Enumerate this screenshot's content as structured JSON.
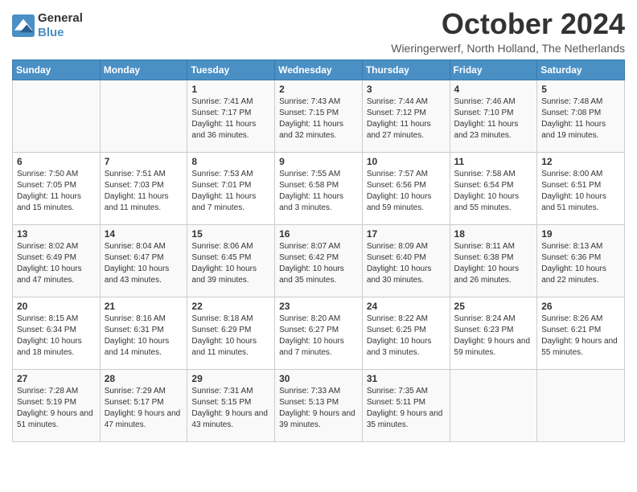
{
  "header": {
    "logo_line1": "General",
    "logo_line2": "Blue",
    "month_title": "October 2024",
    "location": "Wieringerwerf, North Holland, The Netherlands"
  },
  "weekdays": [
    "Sunday",
    "Monday",
    "Tuesday",
    "Wednesday",
    "Thursday",
    "Friday",
    "Saturday"
  ],
  "weeks": [
    [
      {
        "day": "",
        "info": ""
      },
      {
        "day": "",
        "info": ""
      },
      {
        "day": "1",
        "info": "Sunrise: 7:41 AM\nSunset: 7:17 PM\nDaylight: 11 hours and 36 minutes."
      },
      {
        "day": "2",
        "info": "Sunrise: 7:43 AM\nSunset: 7:15 PM\nDaylight: 11 hours and 32 minutes."
      },
      {
        "day": "3",
        "info": "Sunrise: 7:44 AM\nSunset: 7:12 PM\nDaylight: 11 hours and 27 minutes."
      },
      {
        "day": "4",
        "info": "Sunrise: 7:46 AM\nSunset: 7:10 PM\nDaylight: 11 hours and 23 minutes."
      },
      {
        "day": "5",
        "info": "Sunrise: 7:48 AM\nSunset: 7:08 PM\nDaylight: 11 hours and 19 minutes."
      }
    ],
    [
      {
        "day": "6",
        "info": "Sunrise: 7:50 AM\nSunset: 7:05 PM\nDaylight: 11 hours and 15 minutes."
      },
      {
        "day": "7",
        "info": "Sunrise: 7:51 AM\nSunset: 7:03 PM\nDaylight: 11 hours and 11 minutes."
      },
      {
        "day": "8",
        "info": "Sunrise: 7:53 AM\nSunset: 7:01 PM\nDaylight: 11 hours and 7 minutes."
      },
      {
        "day": "9",
        "info": "Sunrise: 7:55 AM\nSunset: 6:58 PM\nDaylight: 11 hours and 3 minutes."
      },
      {
        "day": "10",
        "info": "Sunrise: 7:57 AM\nSunset: 6:56 PM\nDaylight: 10 hours and 59 minutes."
      },
      {
        "day": "11",
        "info": "Sunrise: 7:58 AM\nSunset: 6:54 PM\nDaylight: 10 hours and 55 minutes."
      },
      {
        "day": "12",
        "info": "Sunrise: 8:00 AM\nSunset: 6:51 PM\nDaylight: 10 hours and 51 minutes."
      }
    ],
    [
      {
        "day": "13",
        "info": "Sunrise: 8:02 AM\nSunset: 6:49 PM\nDaylight: 10 hours and 47 minutes."
      },
      {
        "day": "14",
        "info": "Sunrise: 8:04 AM\nSunset: 6:47 PM\nDaylight: 10 hours and 43 minutes."
      },
      {
        "day": "15",
        "info": "Sunrise: 8:06 AM\nSunset: 6:45 PM\nDaylight: 10 hours and 39 minutes."
      },
      {
        "day": "16",
        "info": "Sunrise: 8:07 AM\nSunset: 6:42 PM\nDaylight: 10 hours and 35 minutes."
      },
      {
        "day": "17",
        "info": "Sunrise: 8:09 AM\nSunset: 6:40 PM\nDaylight: 10 hours and 30 minutes."
      },
      {
        "day": "18",
        "info": "Sunrise: 8:11 AM\nSunset: 6:38 PM\nDaylight: 10 hours and 26 minutes."
      },
      {
        "day": "19",
        "info": "Sunrise: 8:13 AM\nSunset: 6:36 PM\nDaylight: 10 hours and 22 minutes."
      }
    ],
    [
      {
        "day": "20",
        "info": "Sunrise: 8:15 AM\nSunset: 6:34 PM\nDaylight: 10 hours and 18 minutes."
      },
      {
        "day": "21",
        "info": "Sunrise: 8:16 AM\nSunset: 6:31 PM\nDaylight: 10 hours and 14 minutes."
      },
      {
        "day": "22",
        "info": "Sunrise: 8:18 AM\nSunset: 6:29 PM\nDaylight: 10 hours and 11 minutes."
      },
      {
        "day": "23",
        "info": "Sunrise: 8:20 AM\nSunset: 6:27 PM\nDaylight: 10 hours and 7 minutes."
      },
      {
        "day": "24",
        "info": "Sunrise: 8:22 AM\nSunset: 6:25 PM\nDaylight: 10 hours and 3 minutes."
      },
      {
        "day": "25",
        "info": "Sunrise: 8:24 AM\nSunset: 6:23 PM\nDaylight: 9 hours and 59 minutes."
      },
      {
        "day": "26",
        "info": "Sunrise: 8:26 AM\nSunset: 6:21 PM\nDaylight: 9 hours and 55 minutes."
      }
    ],
    [
      {
        "day": "27",
        "info": "Sunrise: 7:28 AM\nSunset: 5:19 PM\nDaylight: 9 hours and 51 minutes."
      },
      {
        "day": "28",
        "info": "Sunrise: 7:29 AM\nSunset: 5:17 PM\nDaylight: 9 hours and 47 minutes."
      },
      {
        "day": "29",
        "info": "Sunrise: 7:31 AM\nSunset: 5:15 PM\nDaylight: 9 hours and 43 minutes."
      },
      {
        "day": "30",
        "info": "Sunrise: 7:33 AM\nSunset: 5:13 PM\nDaylight: 9 hours and 39 minutes."
      },
      {
        "day": "31",
        "info": "Sunrise: 7:35 AM\nSunset: 5:11 PM\nDaylight: 9 hours and 35 minutes."
      },
      {
        "day": "",
        "info": ""
      },
      {
        "day": "",
        "info": ""
      }
    ]
  ]
}
